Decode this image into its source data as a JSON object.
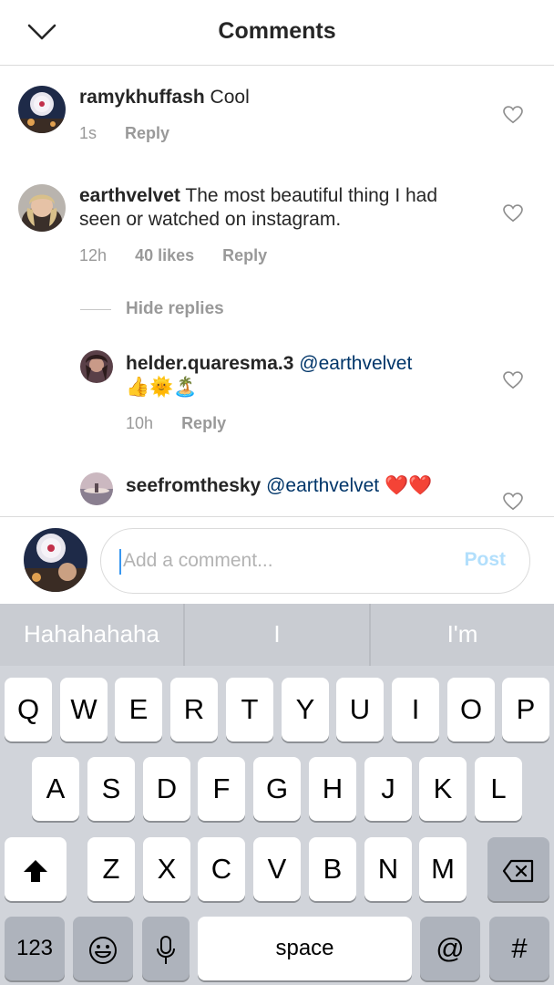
{
  "header": {
    "title": "Comments",
    "back_icon": "chevron-down-icon"
  },
  "comments": [
    {
      "username": "ramykhuffash",
      "text": " Cool",
      "time": "1s",
      "reply_label": "Reply"
    },
    {
      "username": "earthvelvet",
      "text": " The most beautiful thing I had seen or watched on instagram.",
      "time": "12h",
      "likes": "40 likes",
      "reply_label": "Reply"
    }
  ],
  "hide_replies_label": "Hide replies",
  "replies": [
    {
      "username": "helder.quaresma.3",
      "mention": " @earthvelvet",
      "emoji": "👍🌞🏝️",
      "time": "10h",
      "reply_label": "Reply"
    },
    {
      "username": "seefromthesky",
      "mention": " @earthvelvet",
      "emoji": " ❤️❤️"
    }
  ],
  "composer": {
    "placeholder": "Add a comment...",
    "post_label": "Post"
  },
  "keyboard": {
    "suggestions": [
      "Hahahahaha",
      "I",
      "I'm"
    ],
    "row1": [
      "Q",
      "W",
      "E",
      "R",
      "T",
      "Y",
      "U",
      "I",
      "O",
      "P"
    ],
    "row2": [
      "A",
      "S",
      "D",
      "F",
      "G",
      "H",
      "J",
      "K",
      "L"
    ],
    "row3": [
      "Z",
      "X",
      "C",
      "V",
      "B",
      "N",
      "M"
    ],
    "numbers_label": "123",
    "space_label": "space",
    "at_label": "@",
    "hash_label": "#"
  },
  "colors": {
    "text": "#262626",
    "meta": "#999999",
    "mention": "#003569",
    "post_disabled": "#b2dffc",
    "keyboard_bg": "#d1d4da"
  }
}
